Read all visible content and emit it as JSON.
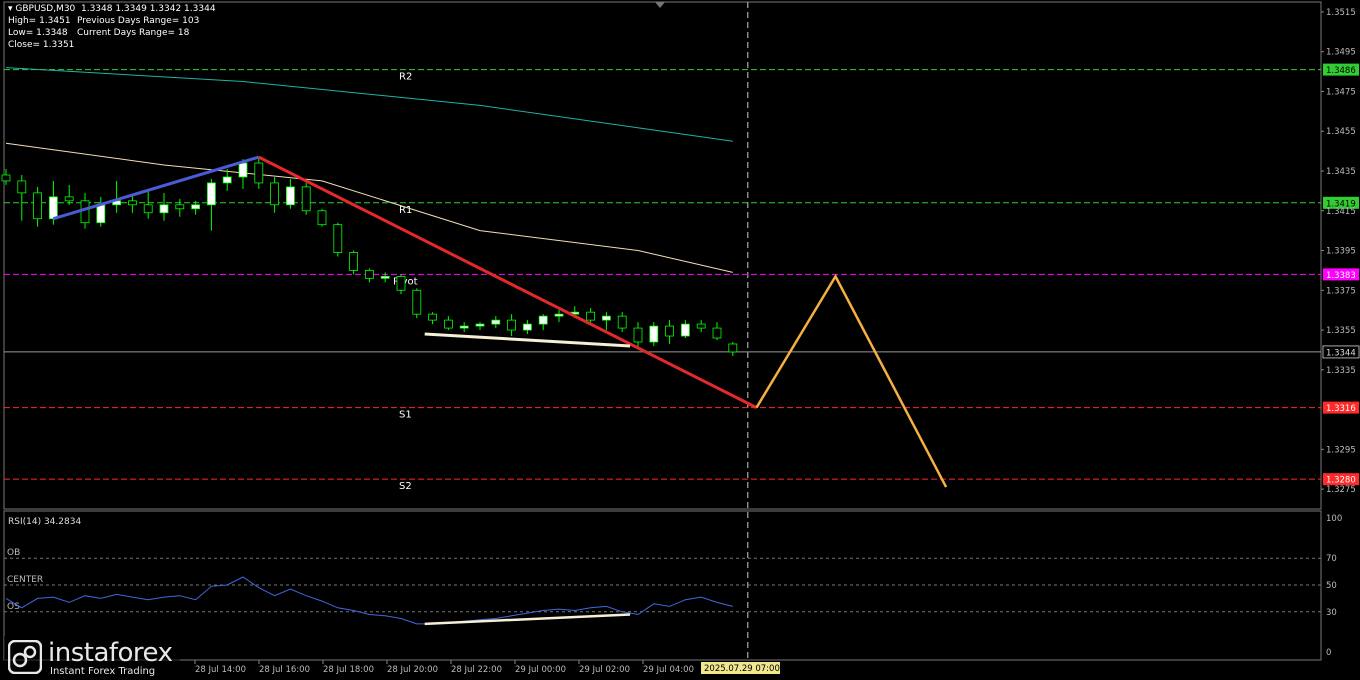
{
  "header": {
    "symbol_line": "GBPUSD,M30  1.3348 1.3349 1.3342 1.3344",
    "high_line": "High= 1.3451",
    "low_line": "Low= 1.3348",
    "close_line": "Close= 1.3351",
    "prev_range_line": "Previous Days Range= 103",
    "curr_range_line": "Current Days Range= 18"
  },
  "watermark": {
    "name": "instaforex",
    "tagline": "Instant Forex Trading"
  },
  "colors": {
    "background": "#000000",
    "bull_candle": "#ffffff",
    "bear_candle": "#000000",
    "candle_outline": "#00ff00",
    "ma_fast": "#f5deb3",
    "ma_slow": "#20b2aa",
    "trend_up": "#4b5bd6",
    "trend_down": "#e32a2a",
    "projection": "#f5b041",
    "r_lines": "#32cd32",
    "pivot_line": "#ff00ff",
    "s_lines": "#ff2a2a",
    "rsi_line": "#4169e1"
  },
  "chart_data": [
    {
      "type": "candlestick",
      "symbol": "GBPUSD",
      "timeframe": "M30",
      "ylim": [
        1.3265,
        1.352
      ],
      "y_ticks": [
        "1.3515",
        "1.3495",
        "1.3475",
        "1.3455",
        "1.3435",
        "1.3415",
        "1.3395",
        "1.3375",
        "1.3355",
        "1.3335",
        "1.3295",
        "1.3275"
      ],
      "x_tick_labels": [
        "28 Jul 14:00",
        "28 Jul 16:00",
        "28 Jul 18:00",
        "28 Jul 20:00",
        "28 Jul 22:00",
        "29 Jul 00:00",
        "29 Jul 02:00",
        "29 Jul 04:00"
      ],
      "current_time_label": "2025.07.29 07:00",
      "candles": [
        {
          "o": 1.3433,
          "h": 1.3436,
          "l": 1.3428,
          "c": 1.343
        },
        {
          "o": 1.343,
          "h": 1.3433,
          "l": 1.341,
          "c": 1.3424
        },
        {
          "o": 1.3424,
          "h": 1.3427,
          "l": 1.3407,
          "c": 1.3411
        },
        {
          "o": 1.3411,
          "h": 1.343,
          "l": 1.3408,
          "c": 1.3422
        },
        {
          "o": 1.3422,
          "h": 1.3428,
          "l": 1.3418,
          "c": 1.342
        },
        {
          "o": 1.342,
          "h": 1.3424,
          "l": 1.3406,
          "c": 1.3409
        },
        {
          "o": 1.3409,
          "h": 1.3422,
          "l": 1.3407,
          "c": 1.3418
        },
        {
          "o": 1.3418,
          "h": 1.343,
          "l": 1.3414,
          "c": 1.342
        },
        {
          "o": 1.342,
          "h": 1.3423,
          "l": 1.3414,
          "c": 1.3418
        },
        {
          "o": 1.3418,
          "h": 1.3425,
          "l": 1.3411,
          "c": 1.3414
        },
        {
          "o": 1.3414,
          "h": 1.3424,
          "l": 1.341,
          "c": 1.3418
        },
        {
          "o": 1.3418,
          "h": 1.3421,
          "l": 1.3412,
          "c": 1.3416
        },
        {
          "o": 1.3416,
          "h": 1.342,
          "l": 1.3413,
          "c": 1.3418
        },
        {
          "o": 1.3418,
          "h": 1.3431,
          "l": 1.3405,
          "c": 1.3429
        },
        {
          "o": 1.3429,
          "h": 1.3436,
          "l": 1.3425,
          "c": 1.3432
        },
        {
          "o": 1.3432,
          "h": 1.3441,
          "l": 1.3426,
          "c": 1.3439
        },
        {
          "o": 1.3439,
          "h": 1.3442,
          "l": 1.3426,
          "c": 1.3429
        },
        {
          "o": 1.3429,
          "h": 1.3432,
          "l": 1.3414,
          "c": 1.3418
        },
        {
          "o": 1.3418,
          "h": 1.3431,
          "l": 1.3416,
          "c": 1.3427
        },
        {
          "o": 1.3427,
          "h": 1.3429,
          "l": 1.3413,
          "c": 1.3415
        },
        {
          "o": 1.3415,
          "h": 1.3416,
          "l": 1.3407,
          "c": 1.3408
        },
        {
          "o": 1.3408,
          "h": 1.3409,
          "l": 1.3392,
          "c": 1.3394
        },
        {
          "o": 1.3394,
          "h": 1.3395,
          "l": 1.3383,
          "c": 1.3385
        },
        {
          "o": 1.3385,
          "h": 1.3386,
          "l": 1.3379,
          "c": 1.3381
        },
        {
          "o": 1.3381,
          "h": 1.3384,
          "l": 1.3379,
          "c": 1.3382
        },
        {
          "o": 1.3382,
          "h": 1.3383,
          "l": 1.3373,
          "c": 1.3375
        },
        {
          "o": 1.3375,
          "h": 1.3376,
          "l": 1.3361,
          "c": 1.3363
        },
        {
          "o": 1.3363,
          "h": 1.3364,
          "l": 1.3358,
          "c": 1.336
        },
        {
          "o": 1.336,
          "h": 1.3362,
          "l": 1.3355,
          "c": 1.3356
        },
        {
          "o": 1.3356,
          "h": 1.3359,
          "l": 1.3354,
          "c": 1.3357
        },
        {
          "o": 1.3357,
          "h": 1.3359,
          "l": 1.3355,
          "c": 1.3358
        },
        {
          "o": 1.3358,
          "h": 1.3362,
          "l": 1.3356,
          "c": 1.336
        },
        {
          "o": 1.336,
          "h": 1.3363,
          "l": 1.3352,
          "c": 1.3355
        },
        {
          "o": 1.3355,
          "h": 1.336,
          "l": 1.3353,
          "c": 1.3358
        },
        {
          "o": 1.3358,
          "h": 1.3363,
          "l": 1.3355,
          "c": 1.3362
        },
        {
          "o": 1.3362,
          "h": 1.3365,
          "l": 1.3359,
          "c": 1.3363
        },
        {
          "o": 1.3363,
          "h": 1.3367,
          "l": 1.3361,
          "c": 1.3364
        },
        {
          "o": 1.3364,
          "h": 1.3366,
          "l": 1.3358,
          "c": 1.336
        },
        {
          "o": 1.336,
          "h": 1.3364,
          "l": 1.3355,
          "c": 1.3362
        },
        {
          "o": 1.3362,
          "h": 1.3364,
          "l": 1.3354,
          "c": 1.3356
        },
        {
          "o": 1.3356,
          "h": 1.3359,
          "l": 1.3346,
          "c": 1.3349
        },
        {
          "o": 1.3349,
          "h": 1.3359,
          "l": 1.3347,
          "c": 1.3357
        },
        {
          "o": 1.3357,
          "h": 1.336,
          "l": 1.3348,
          "c": 1.3352
        },
        {
          "o": 1.3352,
          "h": 1.336,
          "l": 1.3351,
          "c": 1.3358
        },
        {
          "o": 1.3358,
          "h": 1.336,
          "l": 1.3354,
          "c": 1.3356
        },
        {
          "o": 1.3356,
          "h": 1.3359,
          "l": 1.335,
          "c": 1.3351
        },
        {
          "o": 1.3348,
          "h": 1.3349,
          "l": 1.3342,
          "c": 1.3344
        }
      ],
      "levels": [
        {
          "name": "R2",
          "value": 1.3486,
          "label": "1.3486",
          "kind": "r"
        },
        {
          "name": "R1",
          "value": 1.3419,
          "label": "1.3419",
          "kind": "r"
        },
        {
          "name": "Pivot",
          "value": 1.3383,
          "label": "1.3383",
          "kind": "pivot"
        },
        {
          "name": "",
          "value": 1.3344,
          "label": "1.3344",
          "kind": "current"
        },
        {
          "name": "S1",
          "value": 1.3316,
          "label": "1.3316",
          "kind": "s"
        },
        {
          "name": "S2",
          "value": 1.328,
          "label": "1.3280",
          "kind": "s"
        }
      ],
      "ma_fast": [
        [
          0,
          1.3449
        ],
        [
          10,
          1.3438
        ],
        [
          20,
          1.343
        ],
        [
          30,
          1.3405
        ],
        [
          40,
          1.3395
        ],
        [
          46,
          1.3384
        ]
      ],
      "ma_slow": [
        [
          0,
          1.3487
        ],
        [
          15,
          1.348
        ],
        [
          30,
          1.3468
        ],
        [
          46,
          1.345
        ]
      ],
      "trend_up": [
        [
          3,
          1.3411
        ],
        [
          16,
          1.3442
        ]
      ],
      "trend_down": [
        [
          16,
          1.3442
        ],
        [
          47.5,
          1.3316
        ]
      ],
      "support_line": [
        [
          26.5,
          1.3353
        ],
        [
          39.5,
          1.3347
        ]
      ],
      "projection": [
        [
          47.5,
          1.3316
        ],
        [
          52.5,
          1.3382
        ],
        [
          59.5,
          1.3276
        ]
      ]
    },
    {
      "type": "line",
      "title": "RSI(14) 34.2834",
      "ylim": [
        0,
        100
      ],
      "y_ticks": [
        100,
        70,
        50,
        30,
        0
      ],
      "levels": [
        {
          "name": "OB",
          "value": 70
        },
        {
          "name": "CENTER",
          "value": 50
        },
        {
          "name": "OS",
          "value": 30
        }
      ],
      "values": [
        40,
        33,
        40,
        41,
        37,
        42,
        40,
        43,
        41,
        39,
        41,
        42,
        39,
        49,
        50,
        56,
        48,
        42,
        47,
        42,
        38,
        33,
        31,
        28,
        27,
        25,
        21,
        21,
        22,
        23,
        24,
        25,
        27,
        29,
        31,
        32,
        31,
        33,
        34,
        30,
        28,
        36,
        34,
        39,
        41,
        37,
        34
      ],
      "divergence_line": [
        [
          26.5,
          21
        ],
        [
          39.5,
          28
        ]
      ]
    }
  ]
}
